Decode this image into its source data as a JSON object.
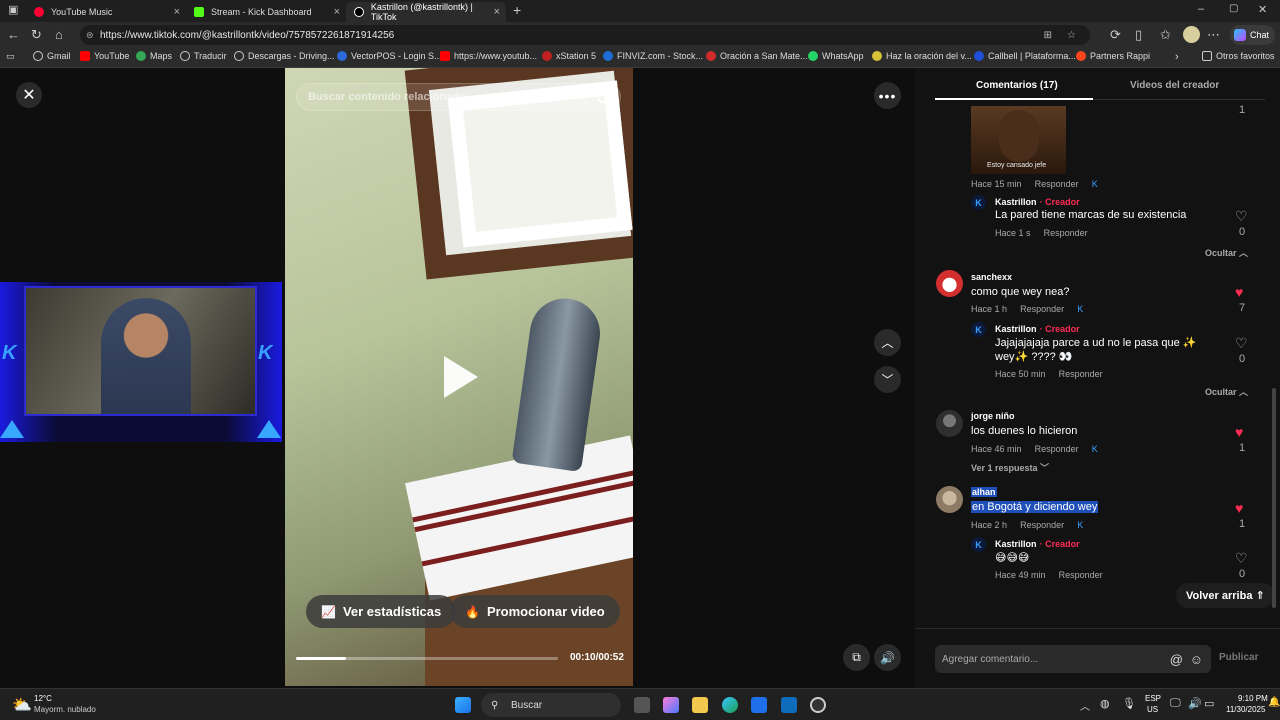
{
  "tabs": [
    {
      "title": "YouTube Music",
      "close": "×"
    },
    {
      "title": "Stream - Kick Dashboard",
      "close": "×"
    },
    {
      "title": "Kastrillon (@kastrillontk) | TikTok",
      "close": "×"
    }
  ],
  "new_tab": "+",
  "window_controls": {
    "minimize": "–",
    "maximize": "▢",
    "close": "✕"
  },
  "address": {
    "url": "https://www.tiktok.com/@kastrillontk/video/7578572261871914256"
  },
  "copilot_label": "Chat",
  "bookmarks": [
    "Gmail",
    "YouTube",
    "Maps",
    "Traducir",
    "Descargas - Driving...",
    "VectorPOS - Login S...",
    "https://www.youtub...",
    "xStation 5",
    "FINVIZ.com - Stock...",
    "Oración a San Mate...",
    "WhatsApp",
    "Haz la oración del v...",
    "Callbell | Plataforma...",
    "Partners Rappi"
  ],
  "bookmarks_more": "›",
  "other_bookmarks": "Otros favoritos",
  "video": {
    "search_placeholder": "Buscar contenido relacionado",
    "close": "✕",
    "more": "•••",
    "up": "︿",
    "down": "﹀",
    "stats_label": "Ver estadísticas",
    "promote_label": "Promocionar video",
    "progress": 0.19,
    "time": "00:10/00:52"
  },
  "panel": {
    "tab_comments": "Comentarios (17)",
    "tab_creator_videos": "Videos del creador",
    "top_like_count": "1",
    "gif_caption": "Estoy cansado jefe",
    "creator_label": "Creador",
    "reply_label": "Responder",
    "hide_label": "Ocultar",
    "comments": [
      {
        "meta_time": "Hace 15 min",
        "reply": {
          "user": "Kastrillon",
          "text": "La pared tiene marcas de su existencia",
          "time": "Hace 1 s",
          "likes": "0"
        }
      },
      {
        "user": "sanchexx",
        "text": "como que wey nea?",
        "time": "Hace 1 h",
        "likes": "7",
        "reply": {
          "user": "Kastrillon",
          "text": "Jajajajajaja parce a ud no le pasa que ✨ wey✨ ???? 👀",
          "time": "Hace 50 min",
          "likes": "0"
        }
      },
      {
        "user": "jorge niño",
        "text": "los duenes lo hicieron",
        "time": "Hace 46 min",
        "likes": "1",
        "more_replies": "Ver 1 respuesta"
      },
      {
        "user": "alhan",
        "text": "en Bogotá y diciendo wey",
        "time": "Hace 2 h",
        "likes": "1",
        "reply": {
          "user": "Kastrillon",
          "text": "😅😅😅",
          "time": "Hace 49 min",
          "likes": "0"
        }
      }
    ],
    "back_to_top": "Volver arriba ⇑",
    "comment_placeholder": "Agregar comentario...",
    "publish": "Publicar"
  },
  "taskbar": {
    "weather_temp": "12°C",
    "weather_desc": "Mayorm. nublado",
    "search": "Buscar",
    "lang": "ESP",
    "lang_region": "US",
    "time": "9:10 PM",
    "date": "11/30/2025"
  }
}
